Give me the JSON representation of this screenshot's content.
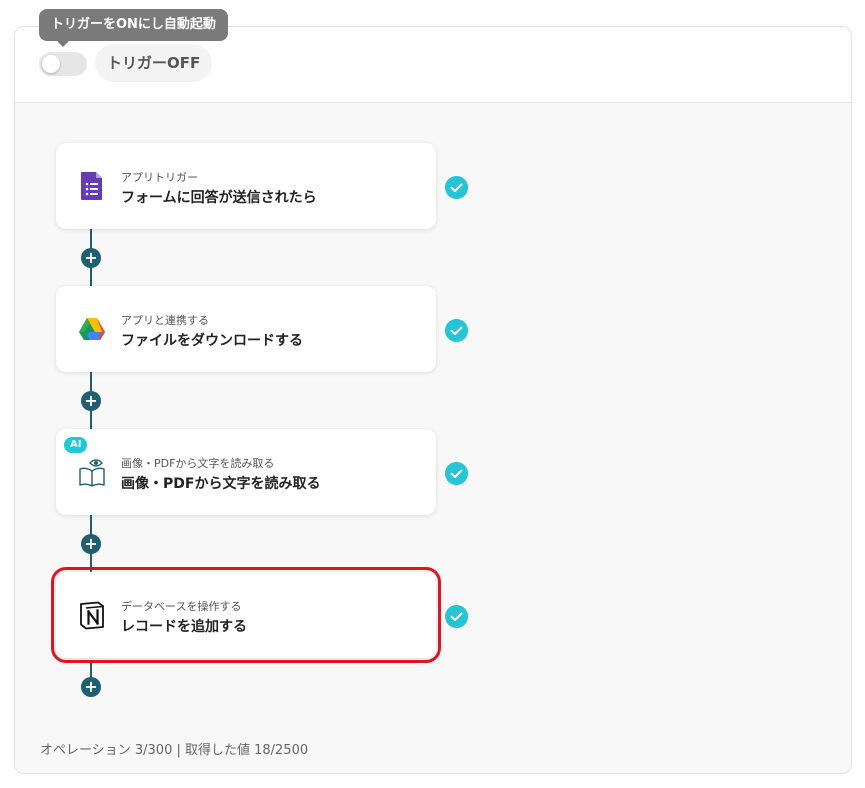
{
  "tooltip": {
    "text": "トリガーをONにし自動起動"
  },
  "trigger": {
    "state_label": "トリガーOFF",
    "enabled": false
  },
  "steps": [
    {
      "caption": "アプリトリガー",
      "title": "フォームに回答が送信されたら",
      "icon": "google-forms-icon",
      "selected": false,
      "ai": false,
      "complete": true
    },
    {
      "caption": "アプリと連携する",
      "title": "ファイルをダウンロードする",
      "icon": "google-drive-icon",
      "selected": false,
      "ai": false,
      "complete": true
    },
    {
      "caption": "画像・PDFから文字を読み取る",
      "title": "画像・PDFから文字を読み取る",
      "icon": "ocr-book-eye-icon",
      "selected": false,
      "ai": true,
      "ai_label": "AI",
      "complete": true
    },
    {
      "caption": "データベースを操作する",
      "title": "レコードを追加する",
      "icon": "notion-icon",
      "selected": true,
      "ai": false,
      "complete": true
    }
  ],
  "add_step_symbol": "+",
  "footer": {
    "stats": "オペレーション 3/300 | 取得した値 18/2500"
  },
  "colors": {
    "connector": "#1f5f73",
    "check": "#27c4d6",
    "ai_badge": "#1ec8d8",
    "selected_outline": "#e0141e",
    "forms_purple": "#673ab7"
  }
}
